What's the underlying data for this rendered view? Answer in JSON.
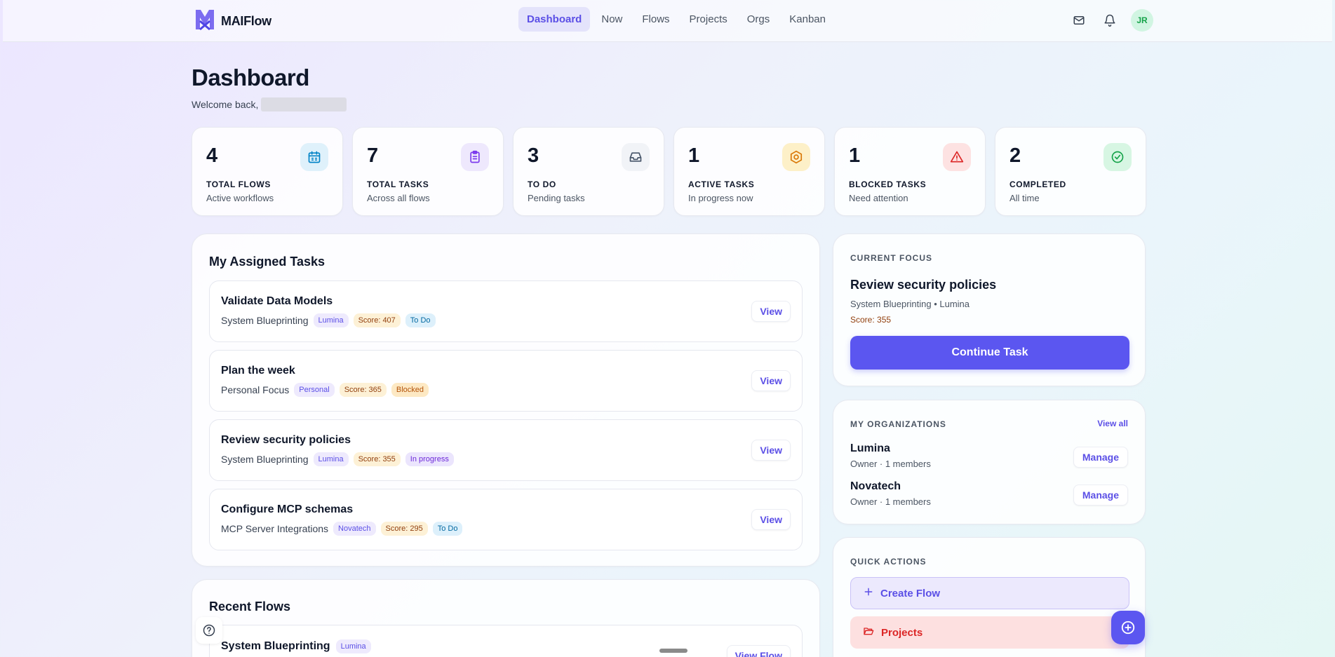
{
  "app": {
    "name": "MAIFlow"
  },
  "nav": {
    "items": [
      {
        "label": "Dashboard",
        "active": true
      },
      {
        "label": "Now"
      },
      {
        "label": "Flows"
      },
      {
        "label": "Projects"
      },
      {
        "label": "Orgs"
      },
      {
        "label": "Kanban"
      }
    ]
  },
  "user": {
    "initials": "JR"
  },
  "page": {
    "title": "Dashboard",
    "welcome": "Welcome back,"
  },
  "stats": [
    {
      "value": "4",
      "label": "TOTAL FLOWS",
      "sub": "Active workflows",
      "icon": "calendar-icon",
      "color": "#0284c7",
      "bg": "#dff1fb"
    },
    {
      "value": "7",
      "label": "TOTAL TASKS",
      "sub": "Across all flows",
      "icon": "clipboard-icon",
      "color": "#7c3aed",
      "bg": "#eee8fd"
    },
    {
      "value": "3",
      "label": "TO DO",
      "sub": "Pending tasks",
      "icon": "inbox-icon",
      "color": "#475569",
      "bg": "#f1f3f7"
    },
    {
      "value": "1",
      "label": "ACTIVE TASKS",
      "sub": "In progress now",
      "icon": "target-icon",
      "color": "#d97706",
      "bg": "#fdf0c8"
    },
    {
      "value": "1",
      "label": "BLOCKED TASKS",
      "sub": "Need attention",
      "icon": "alert-triangle-icon",
      "color": "#dc2626",
      "bg": "#fde2e2"
    },
    {
      "value": "2",
      "label": "COMPLETED",
      "sub": "All time",
      "icon": "check-circle-icon",
      "color": "#16a34a",
      "bg": "#d7f6e3"
    }
  ],
  "assigned": {
    "title": "My Assigned Tasks",
    "view_label": "View",
    "tasks": [
      {
        "name": "Validate Data Models",
        "flow": "System Blueprinting",
        "org": "Lumina",
        "score": "Score: 407",
        "status": "To Do",
        "status_kind": "todo"
      },
      {
        "name": "Plan the week",
        "flow": "Personal Focus",
        "org": "Personal",
        "score": "Score: 365",
        "status": "Blocked",
        "status_kind": "blocked"
      },
      {
        "name": "Review security policies",
        "flow": "System Blueprinting",
        "org": "Lumina",
        "score": "Score: 355",
        "status": "In progress",
        "status_kind": "progress"
      },
      {
        "name": "Configure MCP schemas",
        "flow": "MCP Server Integrations",
        "org": "Novatech",
        "score": "Score: 295",
        "status": "To Do",
        "status_kind": "todo"
      }
    ]
  },
  "recent": {
    "title": "Recent Flows",
    "flows": [
      {
        "name": "System Blueprinting",
        "org": "Lumina",
        "action": "View Flow"
      }
    ]
  },
  "focus": {
    "caption": "CURRENT FOCUS",
    "task": "Review security policies",
    "context": "System Blueprinting • Lumina",
    "score": "Score: 355",
    "button": "Continue Task"
  },
  "orgs": {
    "caption": "MY ORGANIZATIONS",
    "view_all": "View all",
    "manage_label": "Manage",
    "items": [
      {
        "name": "Lumina",
        "sub": "Owner · 1 members"
      },
      {
        "name": "Novatech",
        "sub": "Owner · 1 members"
      }
    ]
  },
  "quick": {
    "caption": "QUICK ACTIONS",
    "actions": [
      {
        "label": "Create Flow",
        "icon": "plus-icon",
        "color": "#5b4fe6",
        "bg": "#ece9fd"
      },
      {
        "label": "Projects",
        "icon": "folder-open-icon",
        "color": "#dc2626",
        "bg": "#fde0e0"
      }
    ]
  }
}
